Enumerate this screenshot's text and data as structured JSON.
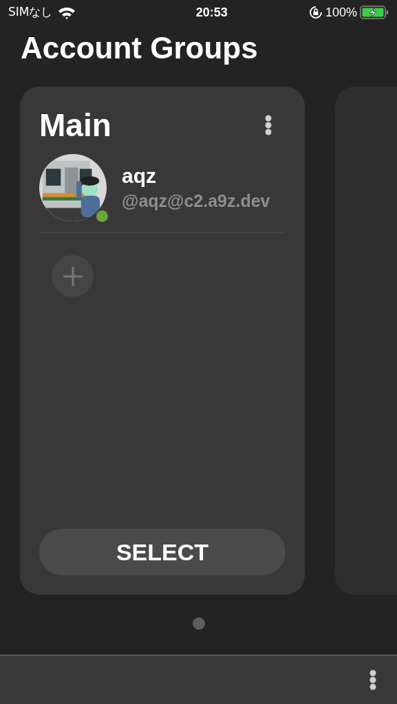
{
  "status_bar": {
    "carrier": "SIMなし",
    "time": "20:53",
    "battery": "100%",
    "charging": true
  },
  "title": "Account Groups",
  "groups": [
    {
      "name": "Main",
      "accounts": [
        {
          "name": "aqz",
          "handle": "@aqz@c2.a9z.dev",
          "online": true
        }
      ],
      "button": "SELECT"
    }
  ],
  "page_dots": [
    {
      "selected": true
    }
  ]
}
